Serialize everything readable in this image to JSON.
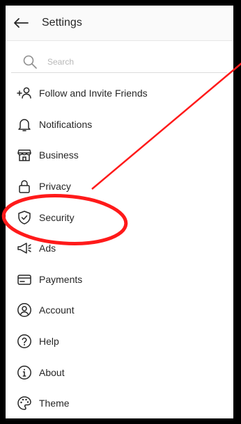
{
  "header": {
    "title": "Settings"
  },
  "search": {
    "placeholder": "Search"
  },
  "menu": {
    "items": [
      {
        "label": "Follow and Invite Friends",
        "icon": "add-person-icon"
      },
      {
        "label": "Notifications",
        "icon": "bell-icon"
      },
      {
        "label": "Business",
        "icon": "storefront-icon"
      },
      {
        "label": "Privacy",
        "icon": "lock-icon"
      },
      {
        "label": "Security",
        "icon": "shield-check-icon"
      },
      {
        "label": "Ads",
        "icon": "megaphone-icon"
      },
      {
        "label": "Payments",
        "icon": "credit-card-icon"
      },
      {
        "label": "Account",
        "icon": "account-circle-icon"
      },
      {
        "label": "Help",
        "icon": "help-circle-icon"
      },
      {
        "label": "About",
        "icon": "info-circle-icon"
      },
      {
        "label": "Theme",
        "icon": "palette-icon"
      }
    ]
  },
  "annotation": {
    "color": "#ff1a1a"
  }
}
